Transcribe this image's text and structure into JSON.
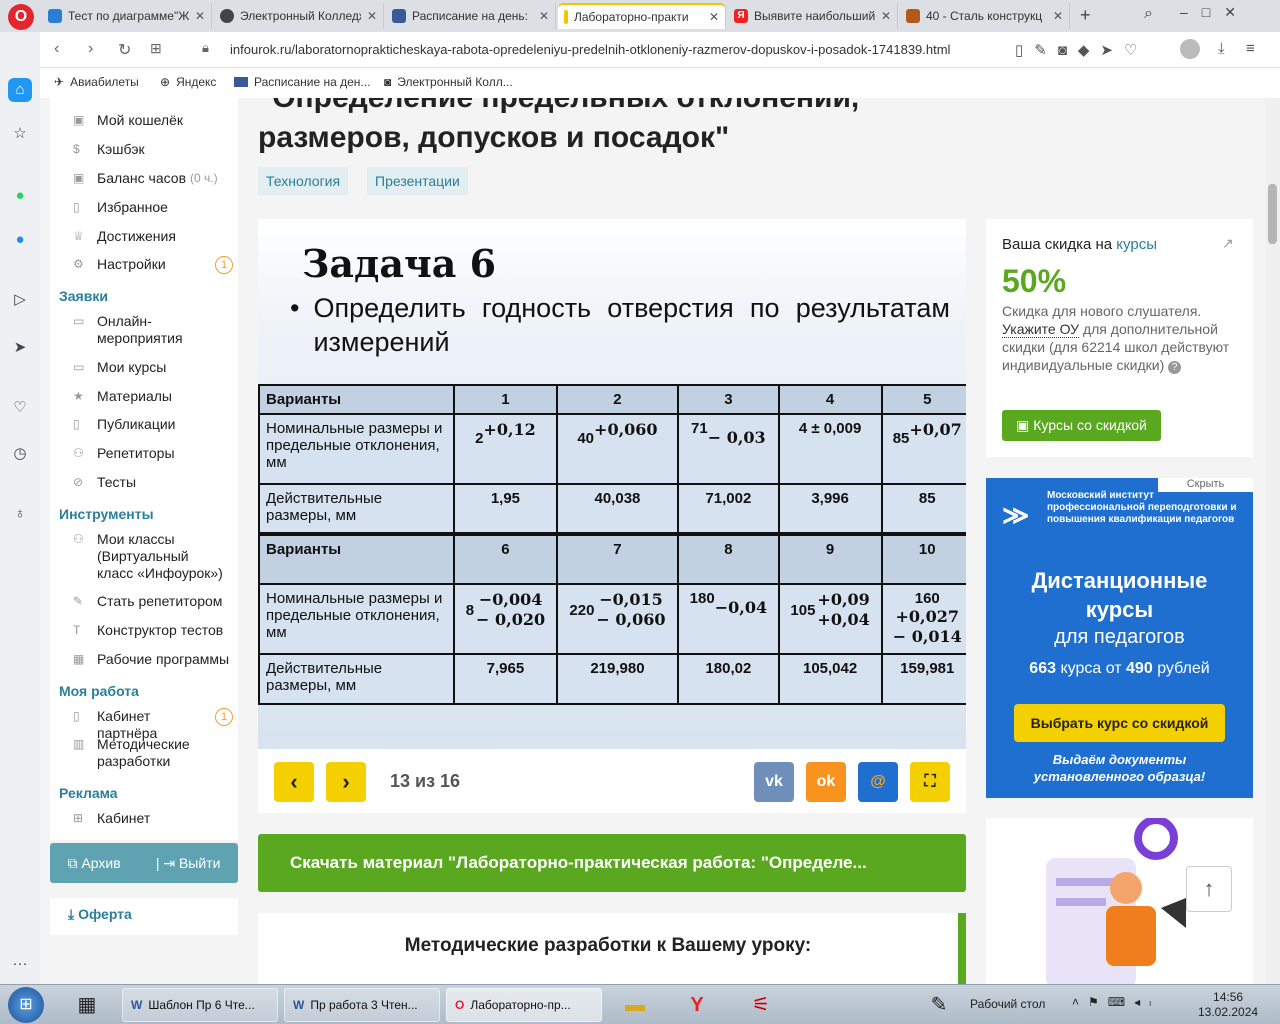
{
  "browser": {
    "tabs": [
      {
        "title": "Тест по диаграмме\"Ж",
        "color": "#2a7fd4"
      },
      {
        "title": "Электронный Колледж",
        "color": "#444"
      },
      {
        "title": "Расписание на день:",
        "color": "#3b5998"
      },
      {
        "title": "Лабораторно-практи",
        "color": "#f4c400"
      },
      {
        "title": "Выявите наибольший",
        "color": "#e22"
      },
      {
        "title": "40 - Сталь конструкц",
        "color": "#b35a1a"
      }
    ],
    "url": "infourok.ru/laboratornoprakticheskaya-rabota-opredeleniyu-predelnih-otkloneniy-razmerov-dopuskov-i-posadok-1741839.html",
    "bookmarks": [
      "Авиабилеты",
      "Яндекс",
      "Расписание на ден...",
      "Электронный Колл..."
    ]
  },
  "sidebar": {
    "items_top": [
      {
        "label": "Мой кошелёк",
        "icon": "wallet-icon"
      },
      {
        "label": "Кэшбэк",
        "icon": "coin-icon"
      },
      {
        "label": "Баланс часов",
        "note": "(0 ч.)",
        "icon": "clock-icon"
      },
      {
        "label": "Избранное",
        "icon": "bookmark-icon"
      },
      {
        "label": "Достижения",
        "icon": "trophy-icon"
      },
      {
        "label": "Настройки",
        "icon": "gear-icon",
        "badge": "1"
      }
    ],
    "sec_applications": "Заявки",
    "items_app": [
      {
        "label": "Онлайн-мероприятия"
      },
      {
        "label": "Мои курсы"
      },
      {
        "label": "Материалы"
      },
      {
        "label": "Публикации"
      },
      {
        "label": "Репетиторы"
      },
      {
        "label": "Тесты"
      }
    ],
    "sec_tools": "Инструменты",
    "items_tools": [
      {
        "label": "Мои классы (Виртуальный класс «Инфоурок»)"
      },
      {
        "label": "Стать репетитором"
      },
      {
        "label": "Конструктор тестов"
      },
      {
        "label": "Рабочие программы"
      }
    ],
    "sec_work": "Моя работа",
    "items_work": [
      {
        "label": "Кабинет партнёра",
        "badge": "1"
      },
      {
        "label": "Методические разработки"
      }
    ],
    "sec_ads": "Реклама",
    "items_ads": [
      {
        "label": "Кабинет"
      }
    ],
    "archive": "Архив",
    "logout": "Выйти",
    "oferta": "Оферта"
  },
  "page": {
    "title_line1": "\"Определение предельных отклонений,",
    "title_line2": "размеров, допусков и посадок\"",
    "tags": [
      "Технология",
      "Презентации"
    ]
  },
  "slide": {
    "title": "Задача 6",
    "bullet": "Определить годность отверстия по результатам измерений",
    "row_variants": "Варианты",
    "row_nominal": "Номинальные размеры и предельные отклонения, мм",
    "row_actual": "Действительные размеры, мм",
    "v1": [
      "1",
      "2",
      "3",
      "4",
      "5"
    ],
    "n1": [
      {
        "base": "2",
        "up": "+0,12",
        "lo": ""
      },
      {
        "base": "40",
        "up": "+0,060",
        "lo": ""
      },
      {
        "base": "71",
        "up": "",
        "lo": "− 0,03"
      },
      {
        "base": "4 ± 0,009",
        "up": "",
        "lo": ""
      },
      {
        "base": "85",
        "up": "+0,07",
        "lo": ""
      }
    ],
    "a1": [
      "1,95",
      "40,038",
      "71,002",
      "3,996",
      "85"
    ],
    "v2": [
      "6",
      "7",
      "8",
      "9",
      "10"
    ],
    "n2": [
      {
        "base": "8",
        "up": "−0,004",
        "lo": "− 0,020"
      },
      {
        "base": "220",
        "up": "−0,015",
        "lo": "− 0,060"
      },
      {
        "base": "180",
        "up": "",
        "lo": "−0,04"
      },
      {
        "base": "105",
        "up": "+0,09",
        "lo": "+0,04"
      },
      {
        "base": "160",
        "up": "+0,027",
        "lo": "− 0,014"
      }
    ],
    "a2": [
      "7,965",
      "219,980",
      "180,02",
      "105,042",
      "159,981"
    ],
    "counter": "13 из 16"
  },
  "download": "Скачать материал \"Лабораторно-практическая работа: \"Определе...",
  "methodical": "Методические разработки к Вашему уроку:",
  "discount": {
    "head": "Ваша скидка на",
    "link": "курсы",
    "percent": "50%",
    "line1": "Скидка для нового слушателя.",
    "link2": "Укажите ОУ",
    "line2": "для дополнительной скидки (для 62214 школ действуют индивидуальные скидки)",
    "button": "Курсы со скидкой"
  },
  "ad": {
    "hide": "Скрыть",
    "org": "Московский институт профессиональной переподготовки и повышения квалификации педагогов",
    "h1": "Дистанционные курсы",
    "h2": "для педагогов",
    "count": "663",
    "count_text": "курса от",
    "price": "490",
    "price_text": "рублей",
    "button": "Выбрать курс со скидкой",
    "foot": "Выдаём документы установленного образца!"
  },
  "taskbar": {
    "items": [
      "Шаблон Пр 6 Чте...",
      "Пр работа 3 Чтен...",
      "Лабораторно-пр..."
    ],
    "desktop": "Рабочий стол",
    "time": "14:56",
    "date": "13.02.2024"
  }
}
